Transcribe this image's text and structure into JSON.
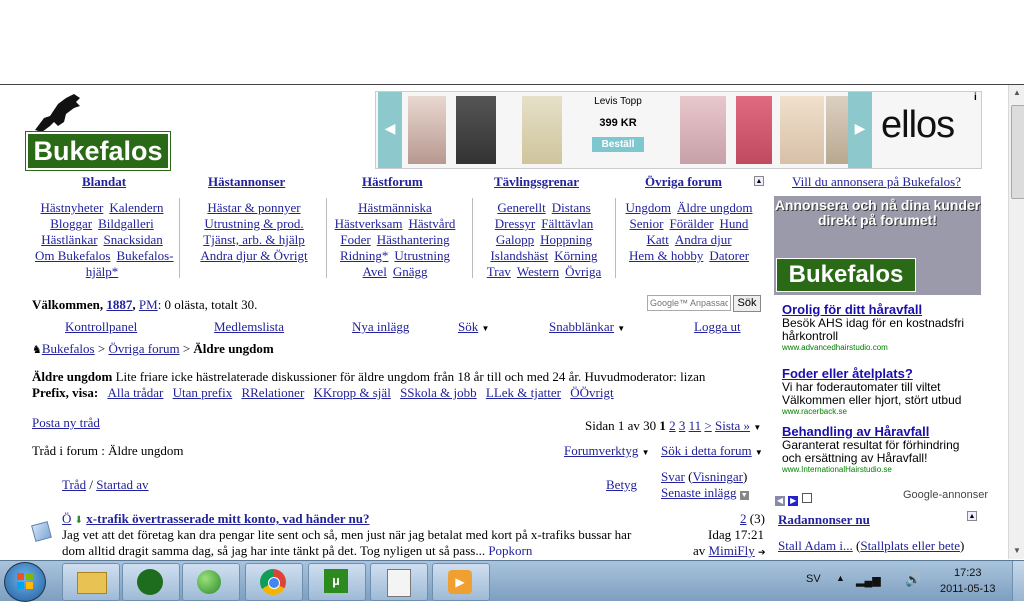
{
  "logo": {
    "text": "Bukefalos"
  },
  "ad_banner": {
    "product": "Levis Topp",
    "price": "399 KR",
    "button": "Beställ",
    "brand": "ellos",
    "info": "i"
  },
  "categories": {
    "headers": [
      "Blandat",
      "Hästannonser",
      "Hästforum",
      "Tävlingsgrenar",
      "Övriga forum"
    ],
    "col1": [
      "Hästnyheter",
      "Kalendern",
      "Bloggar",
      "Bildgalleri",
      "Hästlänkar",
      "Snacksidan",
      "Om Bukefalos",
      "Bukefalos-",
      "hjälp*"
    ],
    "col2": [
      "Hästar & ponnyer",
      "Utrustning & prod.",
      "Tjänst, arb. & hjälp",
      "Andra djur & Övrigt"
    ],
    "col3": [
      "Hästmänniska",
      "Hästverksam",
      "Hästvård",
      "Foder",
      "Hästhantering",
      "Ridning*",
      "Utrustning",
      "Avel",
      "Gnägg"
    ],
    "col4": [
      "Generellt",
      "Distans",
      "Dressyr",
      "Fälttävlan",
      "Galopp",
      "Hoppning",
      "Islandshäst",
      "Körning",
      "Trav",
      "Western",
      "Övriga"
    ],
    "col5": [
      "Ungdom",
      "Äldre ungdom",
      "Senior",
      "Förälder",
      "Hund",
      "Katt",
      "Andra djur",
      "Hem & hobby",
      "Datorer"
    ]
  },
  "sidebar": {
    "advertise_link": "Vill du annonsera på Bukefalos?",
    "ad_text": "Annonsera och nå dina kunder direkt på forumet!",
    "ad_logo": "Bukefalos",
    "google_ads": [
      {
        "title": "Orolig för ditt håravfall",
        "text": "Besök AHS idag för en kostnadsfri hårkontroll",
        "url": "www.advancedhairstudio.com"
      },
      {
        "title": "Foder eller åtelplats?",
        "text": "Vi har foderautomater till viltet Välkommen eller hjort, stört utbud",
        "url": "www.racerback.se"
      },
      {
        "title": "Behandling av Håravfall",
        "text": "Garanterat resultat för förhindring och ersättning av Håravfall!",
        "url": "www.InternationalHairstudio.se"
      }
    ],
    "google_label": "Google-annonser",
    "radannonser": "Radannonser nu",
    "stall_link": "Stall Adam i...",
    "stall_link2": "Stallplats eller bete"
  },
  "welcome": {
    "prefix": "Välkommen,",
    "user": "1887",
    "pm": "PM",
    "status": ": 0 olästa, totalt 30.",
    "search_placeholder": "Google™ Anpassad",
    "search_button": "Sök"
  },
  "nav": [
    "Kontrollpanel",
    "Medlemslista",
    "Nya inlägg",
    "Sök",
    "Snabblänkar",
    "Logga ut"
  ],
  "breadcrumb": {
    "root": "Bukefalos",
    "mid": "Övriga forum",
    "current": "Äldre ungdom"
  },
  "forum": {
    "title": "Äldre ungdom",
    "desc": "Lite friare icke hästrelaterade diskussioner för äldre ungdom från 18 år till och med 24 år. Huvudmoderator: lizan",
    "prefix_label": "Prefix, visa:",
    "prefixes": [
      "Alla trådar",
      "Utan prefix",
      "RRelationer",
      "KKropp & själ",
      "SSkola & jobb",
      "LLek & tjatter",
      "ÖÖvrigt"
    ],
    "post_new": "Posta ny tråd",
    "page_info": "Sidan 1 av 30",
    "pages": [
      "1",
      "2",
      "3",
      "11",
      ">",
      "Sista »"
    ],
    "threads_label": "Tråd i forum : Äldre ungdom",
    "forum_tools": "Forumverktyg",
    "search_forum": "Sök i detta forum"
  },
  "thread_table": {
    "col_thread": "Tråd",
    "col_started": "Startad av",
    "col_rating": "Betyg",
    "col_replies": "Svar",
    "col_views": "Visningar",
    "col_last": "Senaste inlägg"
  },
  "thread": {
    "prefix": "Ö",
    "title": "x-trafik övertrasserade mitt konto, vad händer nu?",
    "preview": "Jag vet att det företag kan dra pengar lite sent och så, men just när jag betalat med kort på x-trafiks bussar har dom alltid dragit samma dag, så jag har inte tänkt på det. Tog nyligen ut så pass...",
    "author": "Popkorn",
    "replies": "2",
    "views": "(3)",
    "last_time": "Idag 17:21",
    "last_by_prefix": "av",
    "last_by": "MimiFly"
  },
  "taskbar": {
    "lang": "SV",
    "time": "17:23",
    "date": "2011-05-13"
  }
}
